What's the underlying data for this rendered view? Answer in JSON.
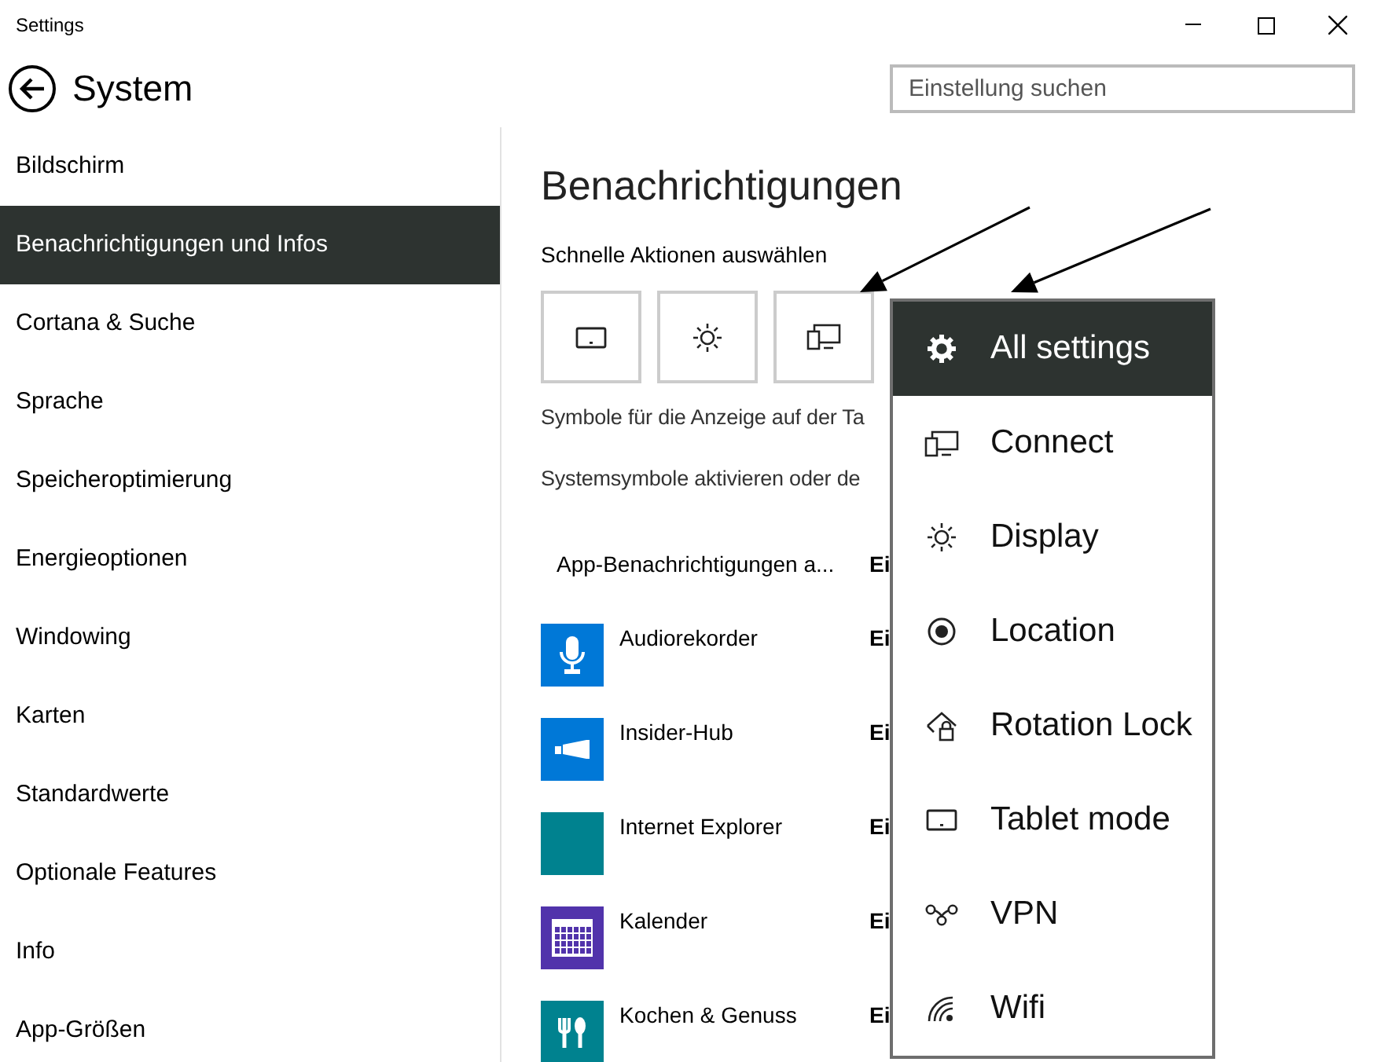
{
  "window": {
    "title": "Settings"
  },
  "header": {
    "title": "System",
    "search": {
      "placeholder": "Einstellung suchen"
    }
  },
  "sidebar": {
    "items": [
      {
        "label": "Bildschirm",
        "selected": false
      },
      {
        "label": "Benachrichtigungen und Infos",
        "selected": true
      },
      {
        "label": "Cortana & Suche",
        "selected": false
      },
      {
        "label": "Sprache",
        "selected": false
      },
      {
        "label": "Speicheroptimierung",
        "selected": false
      },
      {
        "label": "Energieoptionen",
        "selected": false
      },
      {
        "label": "Windowing",
        "selected": false
      },
      {
        "label": "Karten",
        "selected": false
      },
      {
        "label": "Standardwerte",
        "selected": false
      },
      {
        "label": "Optionale Features",
        "selected": false
      },
      {
        "label": "Info",
        "selected": false
      },
      {
        "label": "App-Größen",
        "selected": false
      }
    ]
  },
  "content": {
    "heading": "Benachrichtigungen",
    "quick_actions_label": "Schnelle Aktionen auswählen",
    "quick_actions": [
      {
        "kind": "tablet"
      },
      {
        "kind": "display"
      },
      {
        "kind": "connect"
      }
    ],
    "taskbar_text": "Symbole für die Anzeige auf der Ta",
    "system_icons_text": "Systemsymbole aktivieren oder de",
    "app_notifications": {
      "label": "App-Benachrichtigungen a...",
      "value": "Ei"
    },
    "apps": [
      {
        "name": "Audiorekorder",
        "value": "Ei",
        "kind": "mic",
        "color": "#0078d7"
      },
      {
        "name": "Insider-Hub",
        "value": "Ei",
        "kind": "megaphone",
        "color": "#0078d7"
      },
      {
        "name": "Internet Explorer",
        "value": "Ei",
        "kind": "blank",
        "color": "#00828f"
      },
      {
        "name": "Kalender",
        "value": "Ei",
        "kind": "calendar",
        "color": "#5133ab"
      },
      {
        "name": "Kochen & Genuss",
        "value": "Ei",
        "kind": "utensils",
        "color": "#00828f"
      }
    ]
  },
  "quick_action_menu": {
    "items": [
      {
        "label": "All settings",
        "kind": "gear",
        "selected": true
      },
      {
        "label": "Connect",
        "kind": "connect",
        "selected": false
      },
      {
        "label": "Display",
        "kind": "display",
        "selected": false
      },
      {
        "label": "Location",
        "kind": "location",
        "selected": false
      },
      {
        "label": "Rotation Lock",
        "kind": "rotation",
        "selected": false
      },
      {
        "label": "Tablet mode",
        "kind": "tablet",
        "selected": false
      },
      {
        "label": "VPN",
        "kind": "vpn",
        "selected": false
      },
      {
        "label": "Wifi",
        "kind": "wifi",
        "selected": false
      }
    ]
  }
}
